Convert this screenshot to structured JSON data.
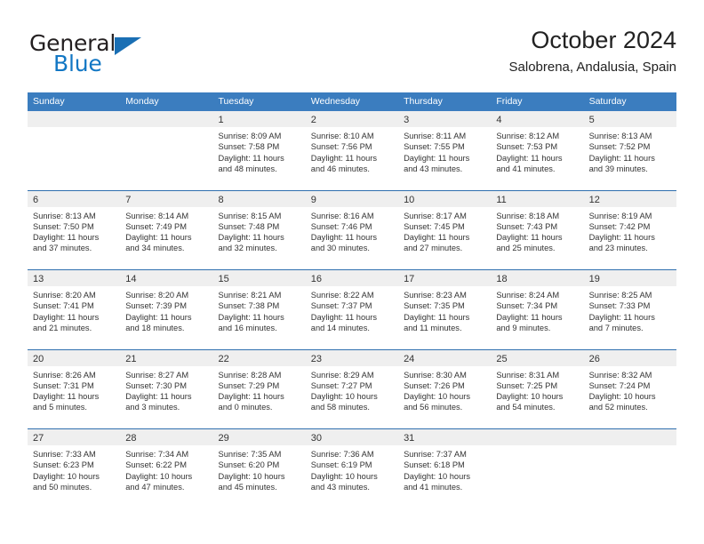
{
  "brand": {
    "name_part1": "General",
    "name_part2": "Blue",
    "triangle_icon": "triangle-icon",
    "accent_color": "#1277c4"
  },
  "header": {
    "title": "October 2024",
    "subtitle": "Salobrena, Andalusia, Spain"
  },
  "theme": {
    "header_blue": "#3b7dbf",
    "separator_blue": "#2f6fae",
    "day_band_gray": "#efefef",
    "text_color": "#333333"
  },
  "weekdays": [
    "Sunday",
    "Monday",
    "Tuesday",
    "Wednesday",
    "Thursday",
    "Friday",
    "Saturday"
  ],
  "weeks": [
    [
      {
        "day": "",
        "empty": true,
        "sunrise": "",
        "sunset": "",
        "daylight1": "",
        "daylight2": ""
      },
      {
        "day": "",
        "empty": true,
        "sunrise": "",
        "sunset": "",
        "daylight1": "",
        "daylight2": ""
      },
      {
        "day": "1",
        "sunrise": "Sunrise: 8:09 AM",
        "sunset": "Sunset: 7:58 PM",
        "daylight1": "Daylight: 11 hours",
        "daylight2": "and 48 minutes."
      },
      {
        "day": "2",
        "sunrise": "Sunrise: 8:10 AM",
        "sunset": "Sunset: 7:56 PM",
        "daylight1": "Daylight: 11 hours",
        "daylight2": "and 46 minutes."
      },
      {
        "day": "3",
        "sunrise": "Sunrise: 8:11 AM",
        "sunset": "Sunset: 7:55 PM",
        "daylight1": "Daylight: 11 hours",
        "daylight2": "and 43 minutes."
      },
      {
        "day": "4",
        "sunrise": "Sunrise: 8:12 AM",
        "sunset": "Sunset: 7:53 PM",
        "daylight1": "Daylight: 11 hours",
        "daylight2": "and 41 minutes."
      },
      {
        "day": "5",
        "sunrise": "Sunrise: 8:13 AM",
        "sunset": "Sunset: 7:52 PM",
        "daylight1": "Daylight: 11 hours",
        "daylight2": "and 39 minutes."
      }
    ],
    [
      {
        "day": "6",
        "sunrise": "Sunrise: 8:13 AM",
        "sunset": "Sunset: 7:50 PM",
        "daylight1": "Daylight: 11 hours",
        "daylight2": "and 37 minutes."
      },
      {
        "day": "7",
        "sunrise": "Sunrise: 8:14 AM",
        "sunset": "Sunset: 7:49 PM",
        "daylight1": "Daylight: 11 hours",
        "daylight2": "and 34 minutes."
      },
      {
        "day": "8",
        "sunrise": "Sunrise: 8:15 AM",
        "sunset": "Sunset: 7:48 PM",
        "daylight1": "Daylight: 11 hours",
        "daylight2": "and 32 minutes."
      },
      {
        "day": "9",
        "sunrise": "Sunrise: 8:16 AM",
        "sunset": "Sunset: 7:46 PM",
        "daylight1": "Daylight: 11 hours",
        "daylight2": "and 30 minutes."
      },
      {
        "day": "10",
        "sunrise": "Sunrise: 8:17 AM",
        "sunset": "Sunset: 7:45 PM",
        "daylight1": "Daylight: 11 hours",
        "daylight2": "and 27 minutes."
      },
      {
        "day": "11",
        "sunrise": "Sunrise: 8:18 AM",
        "sunset": "Sunset: 7:43 PM",
        "daylight1": "Daylight: 11 hours",
        "daylight2": "and 25 minutes."
      },
      {
        "day": "12",
        "sunrise": "Sunrise: 8:19 AM",
        "sunset": "Sunset: 7:42 PM",
        "daylight1": "Daylight: 11 hours",
        "daylight2": "and 23 minutes."
      }
    ],
    [
      {
        "day": "13",
        "sunrise": "Sunrise: 8:20 AM",
        "sunset": "Sunset: 7:41 PM",
        "daylight1": "Daylight: 11 hours",
        "daylight2": "and 21 minutes."
      },
      {
        "day": "14",
        "sunrise": "Sunrise: 8:20 AM",
        "sunset": "Sunset: 7:39 PM",
        "daylight1": "Daylight: 11 hours",
        "daylight2": "and 18 minutes."
      },
      {
        "day": "15",
        "sunrise": "Sunrise: 8:21 AM",
        "sunset": "Sunset: 7:38 PM",
        "daylight1": "Daylight: 11 hours",
        "daylight2": "and 16 minutes."
      },
      {
        "day": "16",
        "sunrise": "Sunrise: 8:22 AM",
        "sunset": "Sunset: 7:37 PM",
        "daylight1": "Daylight: 11 hours",
        "daylight2": "and 14 minutes."
      },
      {
        "day": "17",
        "sunrise": "Sunrise: 8:23 AM",
        "sunset": "Sunset: 7:35 PM",
        "daylight1": "Daylight: 11 hours",
        "daylight2": "and 11 minutes."
      },
      {
        "day": "18",
        "sunrise": "Sunrise: 8:24 AM",
        "sunset": "Sunset: 7:34 PM",
        "daylight1": "Daylight: 11 hours",
        "daylight2": "and 9 minutes."
      },
      {
        "day": "19",
        "sunrise": "Sunrise: 8:25 AM",
        "sunset": "Sunset: 7:33 PM",
        "daylight1": "Daylight: 11 hours",
        "daylight2": "and 7 minutes."
      }
    ],
    [
      {
        "day": "20",
        "sunrise": "Sunrise: 8:26 AM",
        "sunset": "Sunset: 7:31 PM",
        "daylight1": "Daylight: 11 hours",
        "daylight2": "and 5 minutes."
      },
      {
        "day": "21",
        "sunrise": "Sunrise: 8:27 AM",
        "sunset": "Sunset: 7:30 PM",
        "daylight1": "Daylight: 11 hours",
        "daylight2": "and 3 minutes."
      },
      {
        "day": "22",
        "sunrise": "Sunrise: 8:28 AM",
        "sunset": "Sunset: 7:29 PM",
        "daylight1": "Daylight: 11 hours",
        "daylight2": "and 0 minutes."
      },
      {
        "day": "23",
        "sunrise": "Sunrise: 8:29 AM",
        "sunset": "Sunset: 7:27 PM",
        "daylight1": "Daylight: 10 hours",
        "daylight2": "and 58 minutes."
      },
      {
        "day": "24",
        "sunrise": "Sunrise: 8:30 AM",
        "sunset": "Sunset: 7:26 PM",
        "daylight1": "Daylight: 10 hours",
        "daylight2": "and 56 minutes."
      },
      {
        "day": "25",
        "sunrise": "Sunrise: 8:31 AM",
        "sunset": "Sunset: 7:25 PM",
        "daylight1": "Daylight: 10 hours",
        "daylight2": "and 54 minutes."
      },
      {
        "day": "26",
        "sunrise": "Sunrise: 8:32 AM",
        "sunset": "Sunset: 7:24 PM",
        "daylight1": "Daylight: 10 hours",
        "daylight2": "and 52 minutes."
      }
    ],
    [
      {
        "day": "27",
        "sunrise": "Sunrise: 7:33 AM",
        "sunset": "Sunset: 6:23 PM",
        "daylight1": "Daylight: 10 hours",
        "daylight2": "and 50 minutes."
      },
      {
        "day": "28",
        "sunrise": "Sunrise: 7:34 AM",
        "sunset": "Sunset: 6:22 PM",
        "daylight1": "Daylight: 10 hours",
        "daylight2": "and 47 minutes."
      },
      {
        "day": "29",
        "sunrise": "Sunrise: 7:35 AM",
        "sunset": "Sunset: 6:20 PM",
        "daylight1": "Daylight: 10 hours",
        "daylight2": "and 45 minutes."
      },
      {
        "day": "30",
        "sunrise": "Sunrise: 7:36 AM",
        "sunset": "Sunset: 6:19 PM",
        "daylight1": "Daylight: 10 hours",
        "daylight2": "and 43 minutes."
      },
      {
        "day": "31",
        "sunrise": "Sunrise: 7:37 AM",
        "sunset": "Sunset: 6:18 PM",
        "daylight1": "Daylight: 10 hours",
        "daylight2": "and 41 minutes."
      },
      {
        "day": "",
        "empty": true,
        "sunrise": "",
        "sunset": "",
        "daylight1": "",
        "daylight2": ""
      },
      {
        "day": "",
        "empty": true,
        "sunrise": "",
        "sunset": "",
        "daylight1": "",
        "daylight2": ""
      }
    ]
  ]
}
